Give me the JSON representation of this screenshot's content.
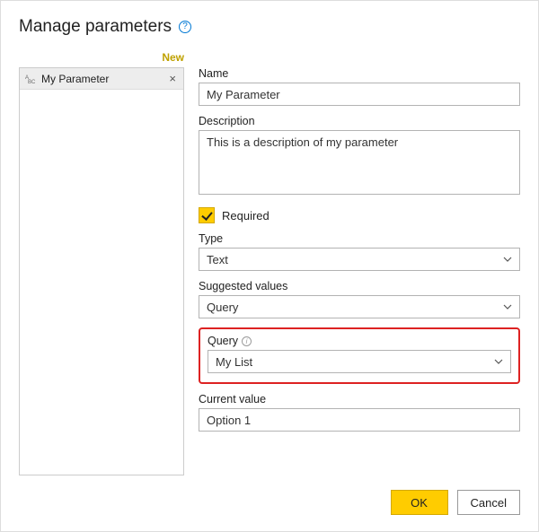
{
  "title": "Manage parameters",
  "toolbar": {
    "new_label": "New"
  },
  "parameter_list": {
    "items": [
      {
        "icon": "abc",
        "name": "My Parameter"
      }
    ]
  },
  "form": {
    "name_label": "Name",
    "name_value": "My Parameter",
    "description_label": "Description",
    "description_value": "This is a description of my parameter",
    "required_label": "Required",
    "required_checked": true,
    "type_label": "Type",
    "type_value": "Text",
    "suggested_values_label": "Suggested values",
    "suggested_values_value": "Query",
    "query_label": "Query",
    "query_value": "My List",
    "current_value_label": "Current value",
    "current_value_value": "Option 1"
  },
  "footer": {
    "ok_label": "OK",
    "cancel_label": "Cancel"
  }
}
